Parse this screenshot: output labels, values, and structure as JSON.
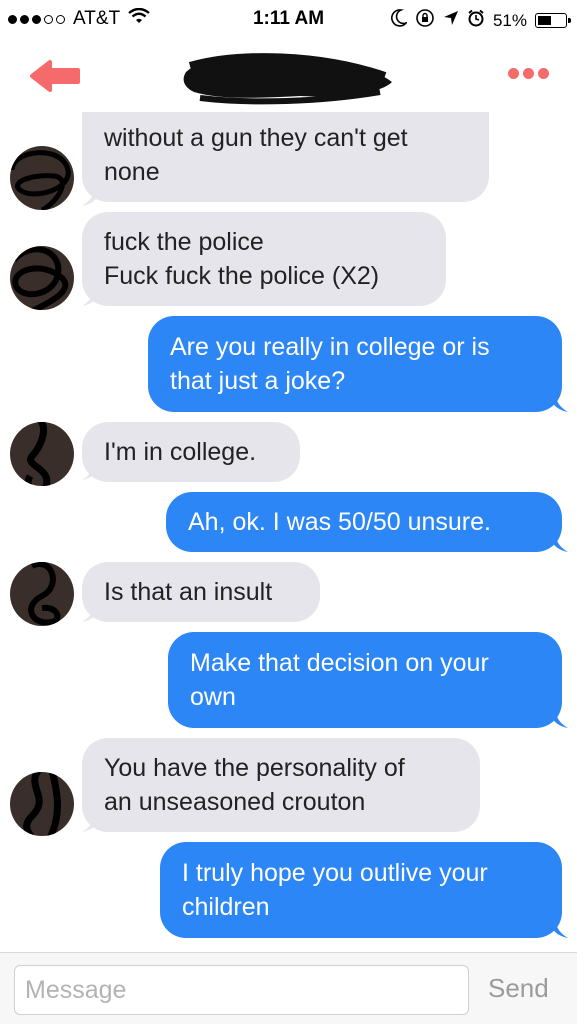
{
  "status_bar": {
    "carrier": "AT&T",
    "time": "1:11 AM",
    "battery_percent": "51%",
    "battery_level": 0.51,
    "signal_strength": 3,
    "icons": [
      "wifi-icon",
      "moon-icon",
      "orientation-lock-icon",
      "location-icon",
      "alarm-icon",
      "battery-icon"
    ]
  },
  "nav": {
    "back_icon": "back-arrow-icon",
    "more_icon": "more-dots-icon",
    "accent_color": "#f56a6a"
  },
  "messages": [
    {
      "from": "them",
      "lines": [
        "without a gun they can't get",
        "none"
      ]
    },
    {
      "from": "them",
      "lines": [
        "fuck the police",
        "Fuck fuck the police (X2)"
      ]
    },
    {
      "from": "me",
      "lines": [
        "Are you really in college or is",
        "that just a joke?"
      ]
    },
    {
      "from": "them",
      "lines": [
        "I'm in college."
      ]
    },
    {
      "from": "me",
      "lines": [
        "Ah, ok. I was 50/50 unsure."
      ]
    },
    {
      "from": "them",
      "lines": [
        "Is that an insult"
      ]
    },
    {
      "from": "me",
      "lines": [
        "Make that decision on your",
        "own"
      ]
    },
    {
      "from": "them",
      "lines": [
        "You have the personality of",
        "an unseasoned crouton"
      ]
    },
    {
      "from": "me",
      "lines": [
        "I truly hope you outlive your",
        "children"
      ]
    }
  ],
  "colors": {
    "incoming_bubble": "#e6e5eb",
    "outgoing_bubble": "#2d86f6"
  },
  "composer": {
    "placeholder": "Message",
    "send_label": "Send"
  }
}
